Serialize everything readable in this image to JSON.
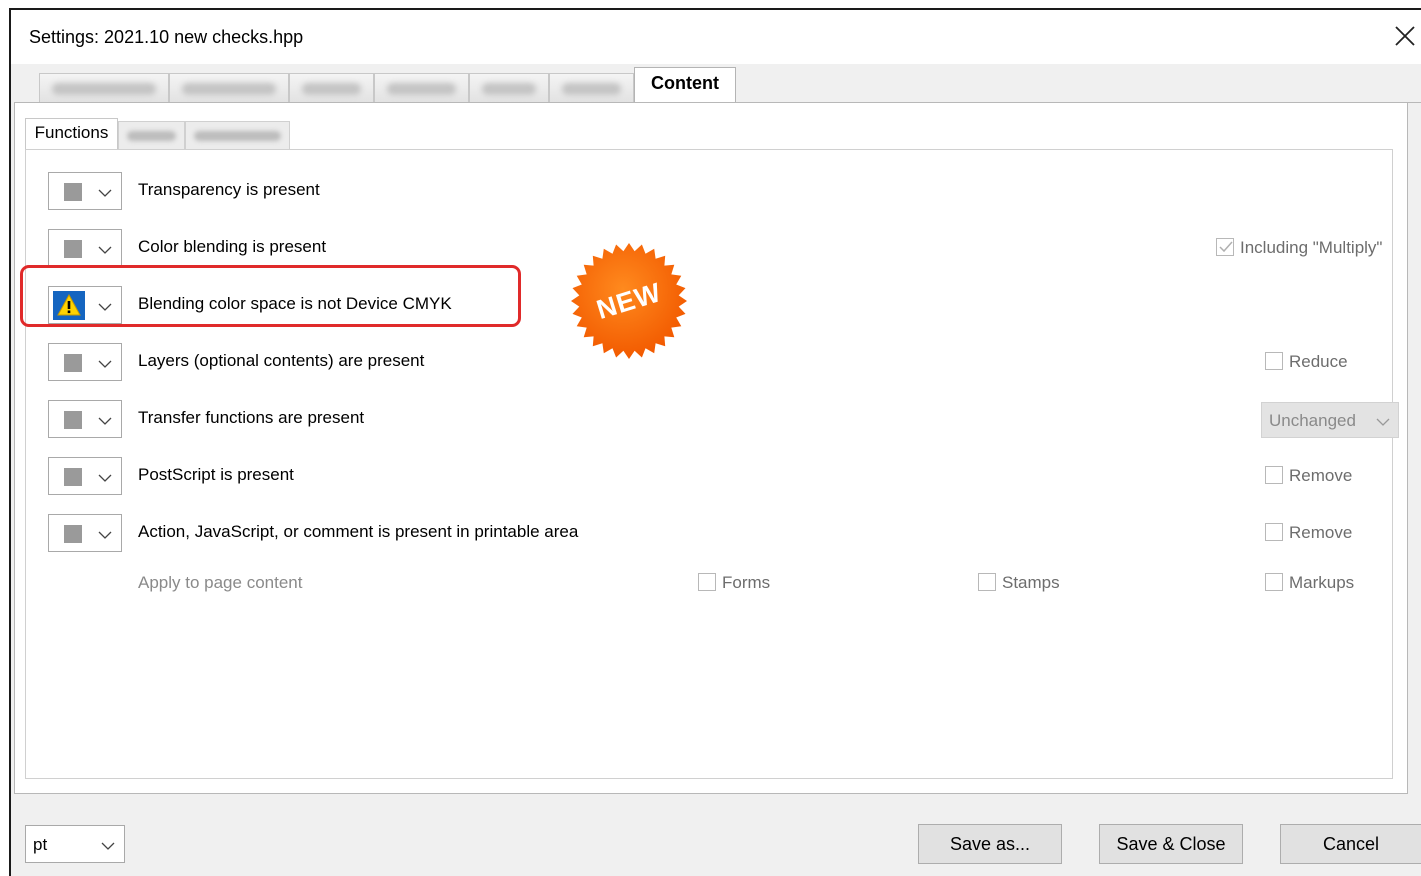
{
  "window": {
    "title": "Settings:  2021.10 new checks.hpp"
  },
  "outer_tabs": {
    "active_label": "Content"
  },
  "inner_tabs": {
    "active_label": "Functions"
  },
  "checks": [
    {
      "label": "Transparency is present",
      "severity": "gray"
    },
    {
      "label": "Color blending is present",
      "severity": "gray",
      "option": "Including \"Multiply\""
    },
    {
      "label": "Blending color space is not Device CMYK",
      "severity": "warning"
    },
    {
      "label": "Layers (optional contents) are present",
      "severity": "gray",
      "option": "Reduce"
    },
    {
      "label": "Transfer functions are present",
      "severity": "gray",
      "option": "Unchanged"
    },
    {
      "label": "PostScript is present",
      "severity": "gray",
      "option": "Remove"
    },
    {
      "label": "Action, JavaScript, or comment is present in printable area",
      "severity": "gray",
      "option": "Remove"
    }
  ],
  "apply": {
    "label": "Apply to page content",
    "forms": "Forms",
    "stamps": "Stamps",
    "markups": "Markups"
  },
  "badge": {
    "text": "NEW",
    "color": "#ff6a00"
  },
  "highlight_color": "#e02a2a",
  "footer": {
    "unit": "pt",
    "save_as": "Save as...",
    "save_close": "Save & Close",
    "cancel": "Cancel"
  }
}
